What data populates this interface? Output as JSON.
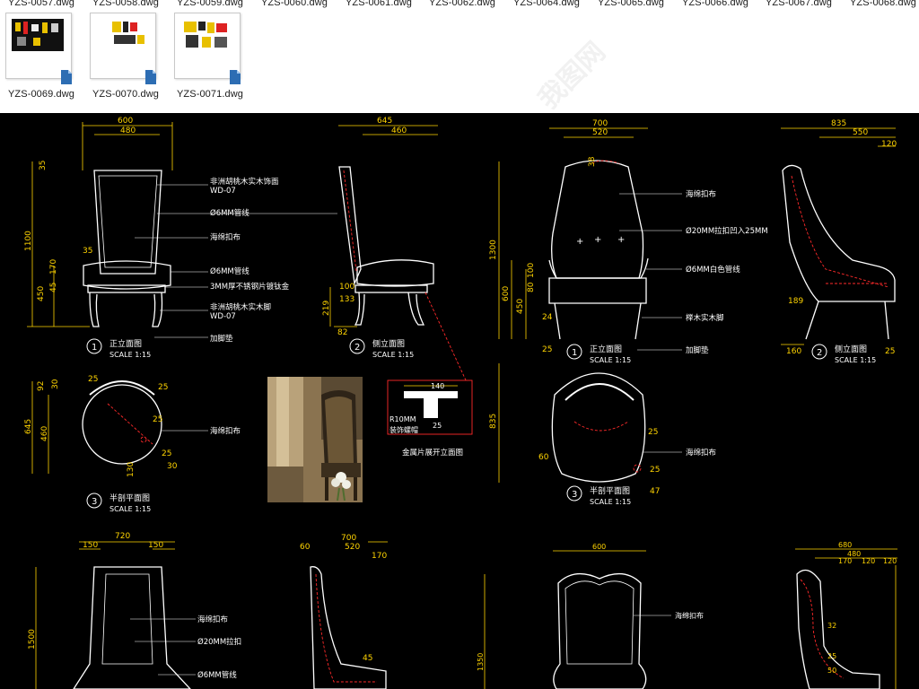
{
  "file_browser": {
    "row1_files": [
      "YZS-0057.dwg",
      "YZS-0058.dwg",
      "YZS-0059.dwg",
      "YZS-0060.dwg",
      "YZS-0061.dwg",
      "YZS-0062.dwg",
      "YZS-0064.dwg",
      "YZS-0065.dwg",
      "YZS-0066.dwg",
      "YZS-0067.dwg",
      "YZS-0068.dwg"
    ],
    "row2_files": [
      "YZS-0069.dwg",
      "YZS-0070.dwg",
      "YZS-0071.dwg"
    ],
    "file_icon": "dwg-file-icon",
    "watermark": "我图网"
  },
  "drawing": {
    "chair1": {
      "front_dims": [
        "600",
        "480",
        "35",
        "1100",
        "35",
        "170",
        "450",
        "45"
      ],
      "side_dims": [
        "645",
        "460",
        "100",
        "133",
        "219",
        "82"
      ],
      "labels": [
        "非洲胡桃木实木饰面",
        "WD-07",
        "Ø6MM管线",
        "海绵扣布",
        "Ø6MM管线",
        "3MM厚不锈钢片镀钛金",
        "非洲胡桃木实木脚",
        "WD-07",
        "加脚垫"
      ],
      "front_title": "正立面图",
      "front_num": "1",
      "side_title": "侧立面图",
      "side_num": "2",
      "scale": "SCALE 1:15",
      "plan_title": "半剖平面图",
      "plan_num": "3",
      "plan_dims": [
        "92",
        "30",
        "645",
        "460",
        "25",
        "25",
        "25",
        "25",
        "30",
        "130"
      ],
      "plan_label": "海绵扣布",
      "detail_dims": [
        "140",
        "25"
      ],
      "detail_labels": [
        "R10MM",
        "装饰螺帽"
      ],
      "detail_title": "金属片展开立面图"
    },
    "chair2": {
      "front_dims": [
        "700",
        "520",
        "38",
        "1300",
        "600",
        "450",
        "80",
        "100",
        "24",
        "25"
      ],
      "side_dims": [
        "835",
        "550",
        "120",
        "189",
        "160",
        "25"
      ],
      "labels": [
        "海绵扣布",
        "Ø20MM拉扣凹入25MM",
        "Ø6MM白色管线",
        "榉木实木脚",
        "加脚垫"
      ],
      "front_title": "正立面图",
      "front_num": "1",
      "side_title": "侧立面图",
      "side_num": "2",
      "scale": "SCALE 1:15",
      "plan_title": "半剖平面图",
      "plan_num": "3",
      "plan_dims": [
        "835",
        "60",
        "25",
        "25",
        "47"
      ],
      "plan_label": "海绵扣布"
    },
    "chair3": {
      "dims": [
        "720",
        "150",
        "150",
        "1500",
        "60",
        "700",
        "520",
        "170",
        "45"
      ],
      "labels": [
        "海绵扣布",
        "Ø20MM拉扣",
        "Ø6MM管线"
      ]
    },
    "chair4": {
      "dims": [
        "600",
        "680",
        "480",
        "170",
        "120",
        "120",
        "1350",
        "32",
        "25",
        "50"
      ],
      "labels": [
        "海绵扣布"
      ]
    }
  },
  "colors": {
    "line": "#ffffff",
    "dim": "#ffd400",
    "red": "#ff2a2a",
    "background": "#000000"
  }
}
